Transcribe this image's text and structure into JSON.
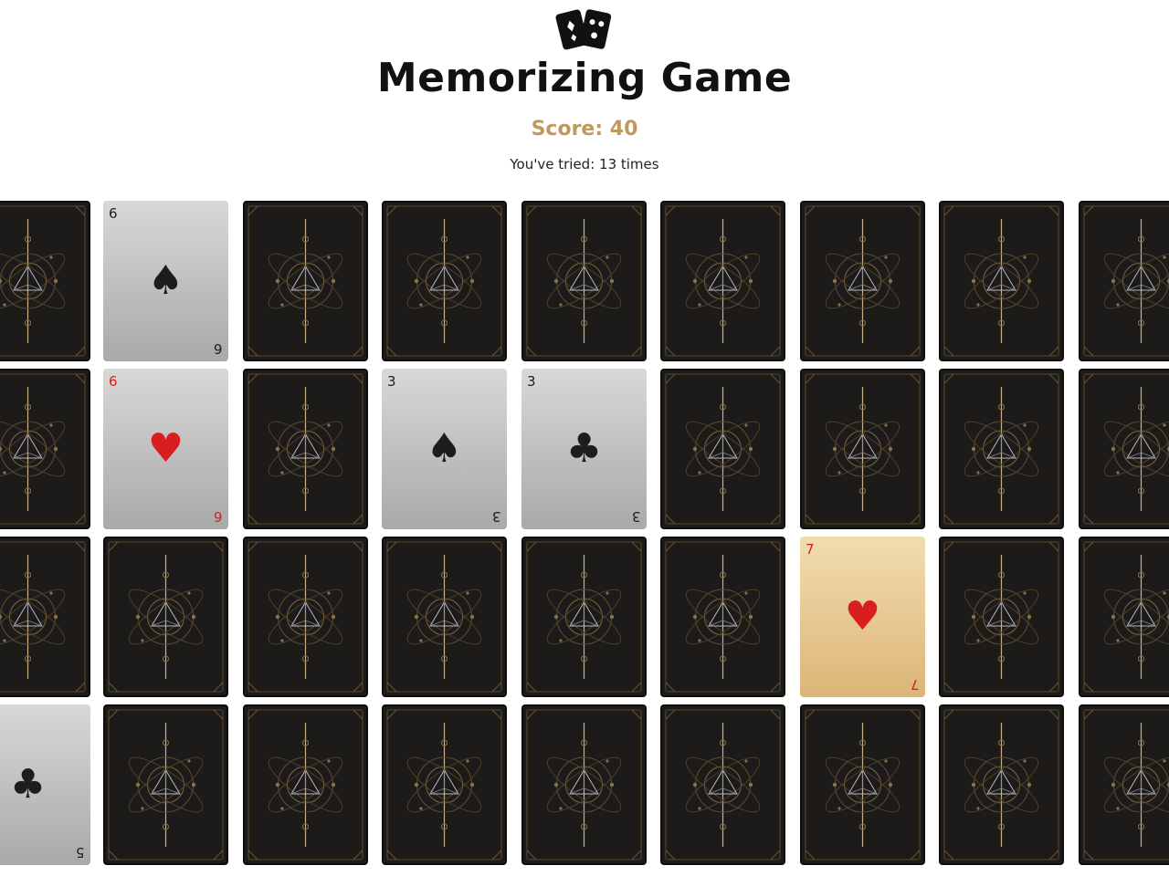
{
  "app": {
    "title": "Memorizing Game",
    "logo_icon": "playing-cards-icon"
  },
  "stats": {
    "score_text": "Score: 40",
    "tries_text": "You've tried: 13 times"
  },
  "colors": {
    "accent": "#c09a5c",
    "card_back": "#1c1b19",
    "red_suit": "#d81e1e",
    "flipped_card": "#b5b5b5",
    "matched_card": "#e6c88f"
  },
  "board": {
    "rows": [
      [
        {
          "state": "down"
        },
        {
          "state": "up",
          "rank": "6",
          "suit": "♠",
          "suit_name": "spade-icon",
          "color": "black"
        },
        {
          "state": "down"
        },
        {
          "state": "down"
        },
        {
          "state": "down"
        },
        {
          "state": "down"
        },
        {
          "state": "down"
        },
        {
          "state": "down"
        },
        {
          "state": "down"
        }
      ],
      [
        {
          "state": "down"
        },
        {
          "state": "up",
          "rank": "6",
          "suit": "♥",
          "suit_name": "heart-icon",
          "color": "red"
        },
        {
          "state": "down"
        },
        {
          "state": "up",
          "rank": "3",
          "suit": "♠",
          "suit_name": "spade-icon",
          "color": "black"
        },
        {
          "state": "up",
          "rank": "3",
          "suit": "♣",
          "suit_name": "club-icon",
          "color": "black"
        },
        {
          "state": "down"
        },
        {
          "state": "down"
        },
        {
          "state": "down"
        },
        {
          "state": "down"
        }
      ],
      [
        {
          "state": "down"
        },
        {
          "state": "down"
        },
        {
          "state": "down"
        },
        {
          "state": "down"
        },
        {
          "state": "down"
        },
        {
          "state": "down"
        },
        {
          "state": "matched",
          "rank": "7",
          "suit": "♥",
          "suit_name": "heart-icon",
          "color": "red"
        },
        {
          "state": "down"
        },
        {
          "state": "down"
        }
      ],
      [
        {
          "state": "up",
          "rank": "5",
          "suit": "♣",
          "suit_name": "club-icon",
          "color": "black"
        },
        {
          "state": "down"
        },
        {
          "state": "down"
        },
        {
          "state": "down"
        },
        {
          "state": "down"
        },
        {
          "state": "down"
        },
        {
          "state": "down"
        },
        {
          "state": "down"
        },
        {
          "state": "down"
        }
      ]
    ]
  }
}
